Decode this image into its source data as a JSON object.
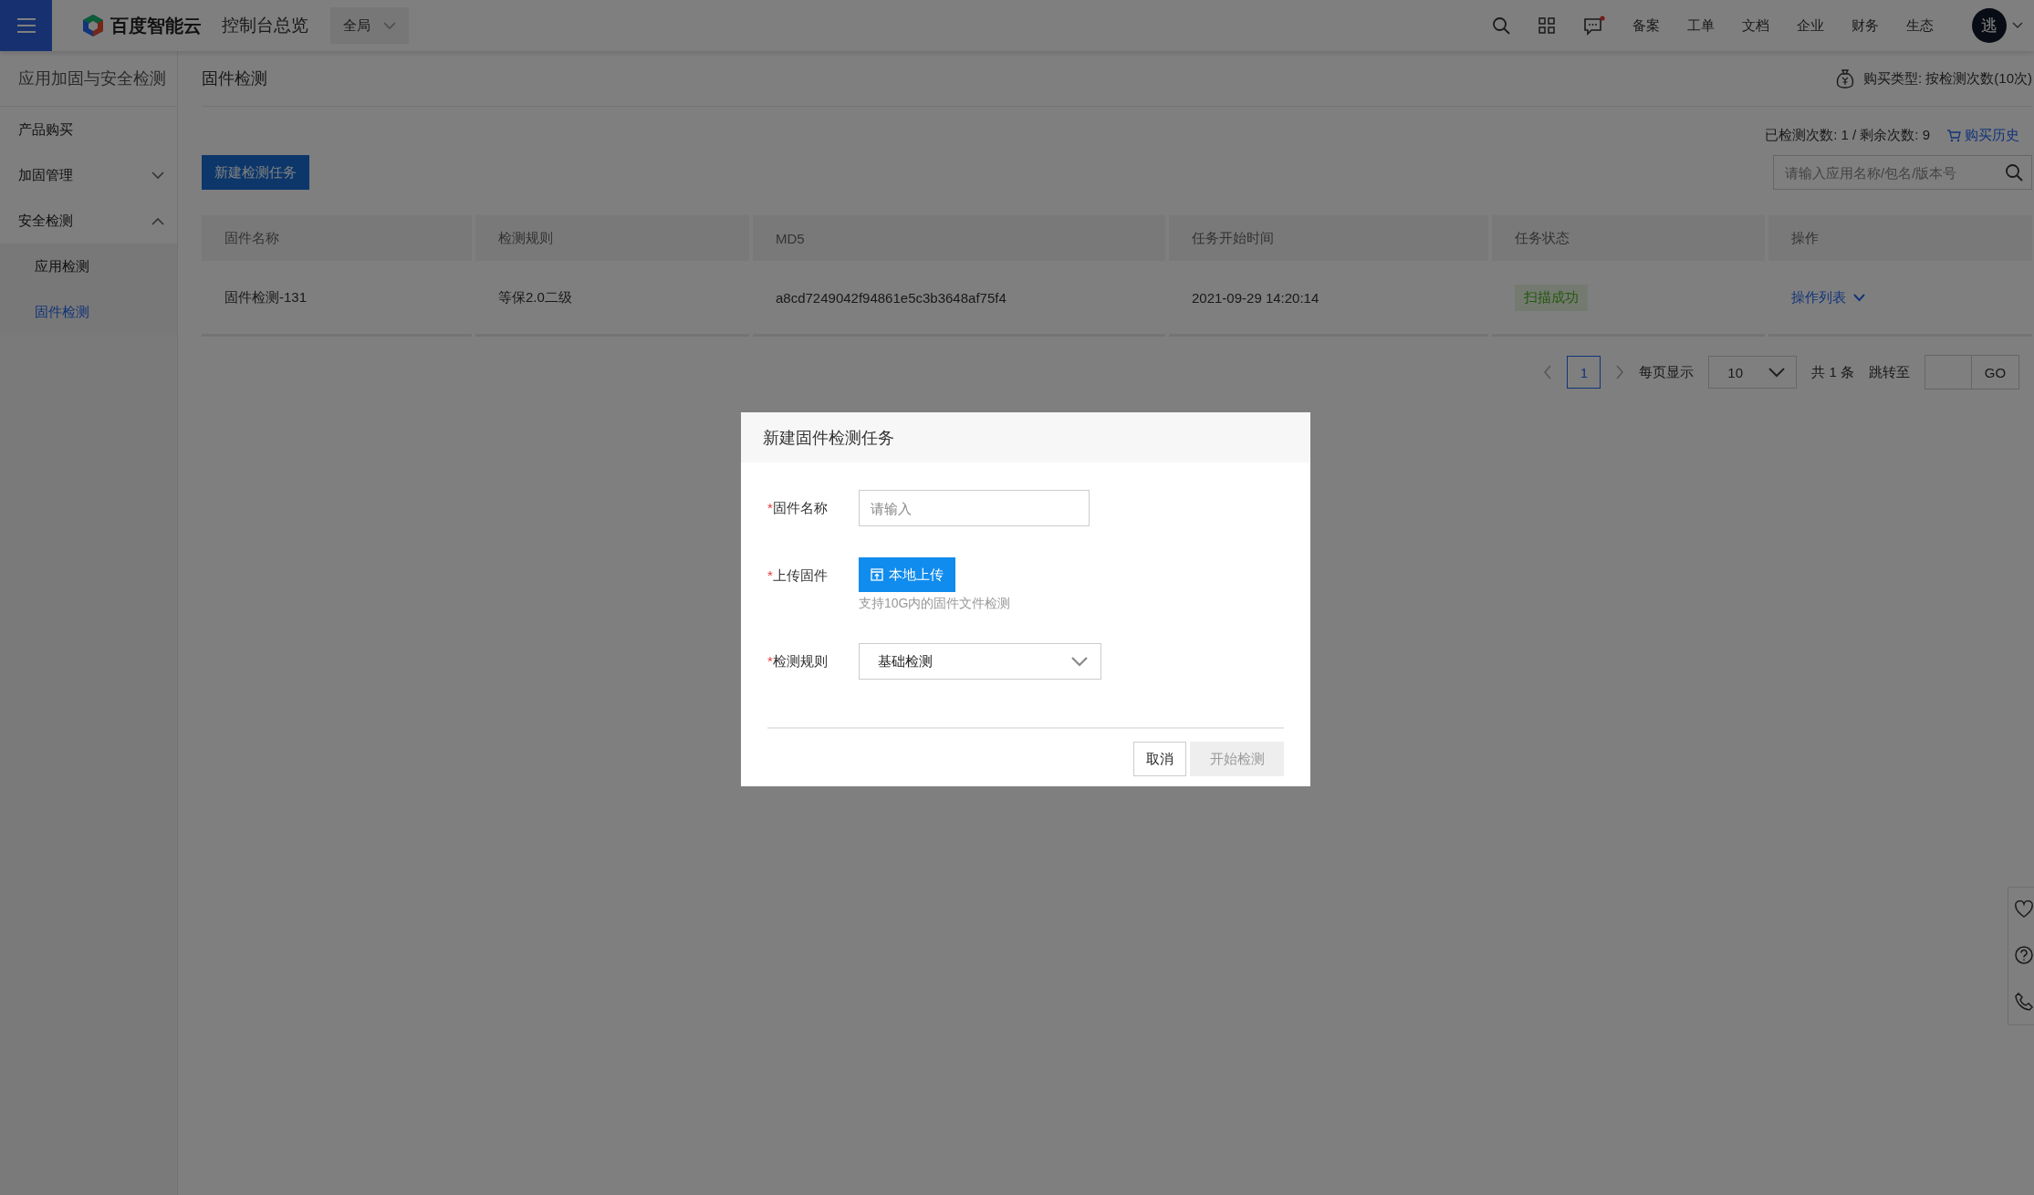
{
  "topbar": {
    "brand": "百度智能云",
    "console": "控制台总览",
    "region": "全局",
    "notifications_unread": true,
    "nav": [
      "备案",
      "工单",
      "文档",
      "企业",
      "财务",
      "生态"
    ],
    "avatar": "逃"
  },
  "sidebar": {
    "title": "应用加固与安全检测",
    "items": [
      {
        "label": "产品购买",
        "selected": false
      },
      {
        "label": "加固管理",
        "expanded": false,
        "selected": false
      },
      {
        "label": "安全检测",
        "expanded": true,
        "selected": false,
        "children": [
          {
            "label": "应用检测",
            "selected": false
          },
          {
            "label": "固件检测",
            "selected": true
          }
        ]
      }
    ]
  },
  "header": {
    "title": "固件检测",
    "purchase_type": "购买类型: 按检测次数(10次)"
  },
  "usage": {
    "text": "已检测次数: 1 / 剩余次数: 9",
    "link": "购买历史"
  },
  "new_task_button": "新建检测任务",
  "search": {
    "placeholder": "请输入应用名称/包名/版本号"
  },
  "table": {
    "columns": [
      "固件名称",
      "检测规则",
      "MD5",
      "任务开始时间",
      "任务状态",
      "操作"
    ],
    "rows": [
      {
        "name": "固件检测-131",
        "rule": "等保2.0二级",
        "md5": "a8cd7249042f94861e5c3b3648af75f4",
        "start_time": "2021-09-29 14:20:14",
        "status": {
          "kind": "success",
          "text": "扫描成功"
        },
        "action": "操作列表"
      }
    ]
  },
  "pagination": {
    "pages": [
      {
        "label": "1",
        "selected": true
      }
    ],
    "per_page_label": "每页显示",
    "per_page": "10",
    "total": "共 1 条",
    "jump_label": "跳转至",
    "go": "GO"
  },
  "modal": {
    "title": "新建固件检测任务",
    "fields": [
      {
        "kind": "input",
        "label": "固件名称",
        "required": true,
        "required_mark": "*",
        "placeholder": "请输入"
      },
      {
        "kind": "upload",
        "label": "上传固件",
        "required": true,
        "required_mark": "*",
        "button": "本地上传",
        "hint": "支持10G内的固件文件检测"
      },
      {
        "kind": "select",
        "label": "检测规则",
        "required": true,
        "required_mark": "*",
        "value": "基础检测"
      }
    ],
    "buttons": [
      {
        "label": "取消",
        "disabled": false
      },
      {
        "label": "开始检测",
        "disabled": true
      }
    ]
  }
}
